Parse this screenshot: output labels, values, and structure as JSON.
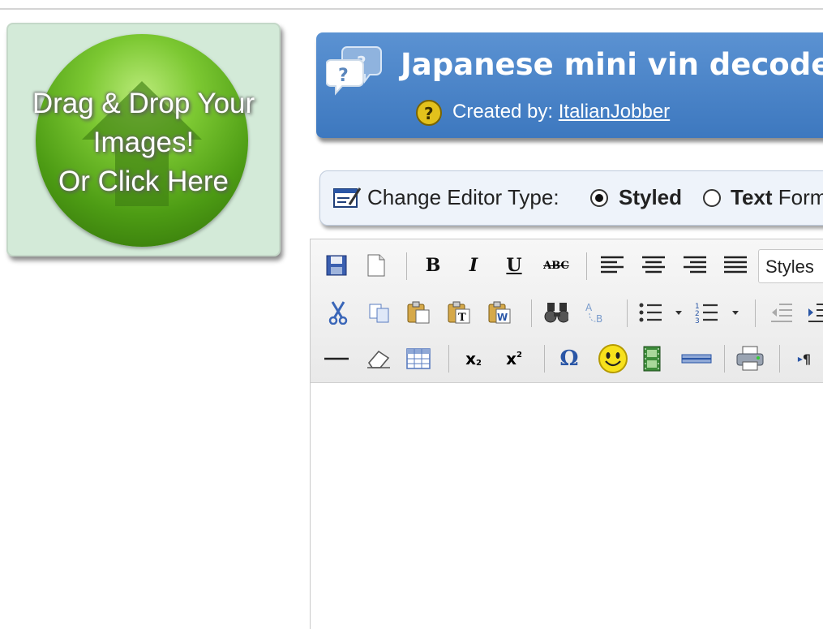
{
  "dropzone": {
    "line1": "Drag & Drop Your",
    "line2": "Images!",
    "line3": "Or Click Here"
  },
  "header": {
    "title": "Japanese mini vin decoder",
    "created_label": "Created by:",
    "author": "ItalianJobber"
  },
  "editor_type": {
    "label": "Change Editor Type:",
    "options": [
      {
        "label": "Styled",
        "selected": true
      },
      {
        "label_bold": "Text",
        "label_rest": " Format",
        "selected": false
      }
    ]
  },
  "toolbar": {
    "styles_dropdown": "Styles",
    "buttons": [
      "save",
      "new-page",
      "bold",
      "italic",
      "underline",
      "strikethrough",
      "align-left",
      "align-center",
      "align-right",
      "justify",
      "cut",
      "copy",
      "paste",
      "paste-text",
      "paste-word",
      "find",
      "replace",
      "bulleted-list",
      "numbered-list",
      "outdent",
      "indent",
      "horizontal-line",
      "eraser",
      "table",
      "subscript",
      "superscript",
      "special-char",
      "smiley",
      "media",
      "page-break",
      "print",
      "show-blocks"
    ]
  },
  "colors": {
    "banner": "#4a85c9",
    "dropzone_bg": "#d3ead8",
    "button_green": "#5aa61c"
  }
}
